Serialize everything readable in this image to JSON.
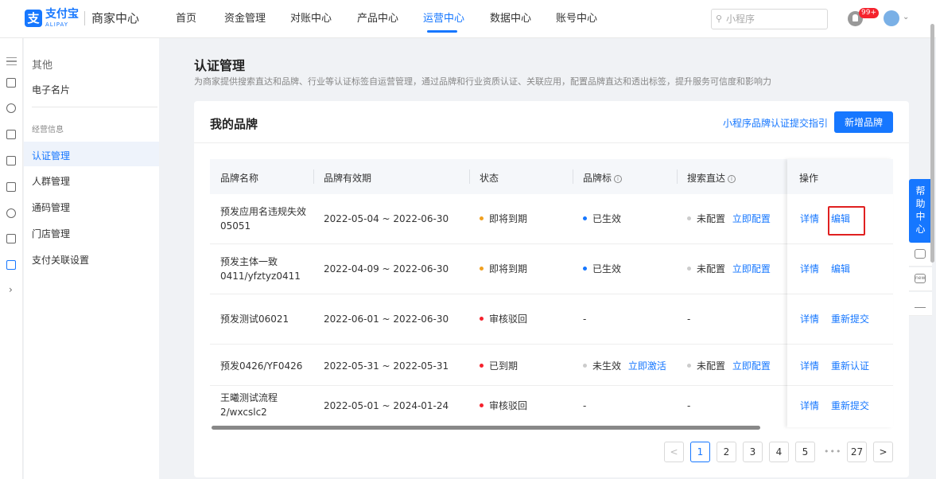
{
  "header": {
    "logo_mark": "支",
    "logo_text": "支付宝",
    "logo_sub": "ALIPAY",
    "app_name": "商家中心",
    "nav": [
      "首页",
      "资金管理",
      "对账中心",
      "产品中心",
      "运营中心",
      "数据中心",
      "账号中心"
    ],
    "active_nav": "运营中心",
    "search_placeholder": "小程序",
    "notification_badge": "99+"
  },
  "sidebar": {
    "group_other": "其他",
    "item_card": "电子名片",
    "section_business": "经营信息",
    "items": [
      "认证管理",
      "人群管理",
      "通码管理",
      "门店管理",
      "支付关联设置"
    ],
    "active_item": "认证管理"
  },
  "page": {
    "title": "认证管理",
    "description": "为商家提供搜索直达和品牌、行业等认证标签自运营管理，通过品牌和行业资质认证、关联应用，配置品牌直达和透出标签，提升服务可信度和影响力"
  },
  "card": {
    "title": "我的品牌",
    "guide_link": "小程序品牌认证提交指引",
    "add_button": "新增品牌"
  },
  "table": {
    "columns": [
      "品牌名称",
      "品牌有效期",
      "状态",
      "品牌标",
      "搜索直达",
      "操作"
    ],
    "info_glyph": "i",
    "rows": [
      {
        "name": "预发应用名违规失效05051",
        "period": "2022-05-04 ~ 2022-06-30",
        "status": "即将到期",
        "status_color": "#f0a020",
        "mark": "已生效",
        "mark_color": "#1677ff",
        "mark_action": "",
        "search": "未配置",
        "search_action": "立即配置",
        "op1": "详情",
        "op2": "编辑"
      },
      {
        "name": "预发主体一致0411/yfztyz0411",
        "period": "2022-04-09 ~ 2022-06-30",
        "status": "即将到期",
        "status_color": "#f0a020",
        "mark": "已生效",
        "mark_color": "#1677ff",
        "mark_action": "",
        "search": "未配置",
        "search_action": "立即配置",
        "op1": "详情",
        "op2": "编辑"
      },
      {
        "name": "预发测试06021",
        "period": "2022-06-01 ~ 2022-06-30",
        "status": "审核驳回",
        "status_color": "#f5222d",
        "mark": "-",
        "mark_color": "",
        "mark_action": "",
        "search": "-",
        "search_action": "",
        "op1": "详情",
        "op2": "重新提交"
      },
      {
        "name": "预发0426/YF0426",
        "period": "2022-05-31 ~ 2022-05-31",
        "status": "已到期",
        "status_color": "#f5222d",
        "mark": "未生效",
        "mark_color": "#cccccc",
        "mark_action": "立即激活",
        "search": "未配置",
        "search_action": "立即配置",
        "op1": "详情",
        "op2": "重新认证"
      },
      {
        "name": "王曦测试流程2/wxcslc2",
        "period": "2022-05-01 ~ 2024-01-24",
        "status": "审核驳回",
        "status_color": "#f5222d",
        "mark": "-",
        "mark_color": "",
        "mark_action": "",
        "search": "-",
        "search_action": "",
        "op1": "详情",
        "op2": "重新提交"
      }
    ]
  },
  "pagination": {
    "prev": "<",
    "pages": [
      "1",
      "2",
      "3",
      "4",
      "5"
    ],
    "ellipsis": "•••",
    "last": "27",
    "next": ">",
    "current": "1"
  },
  "help": {
    "label": "帮助中心",
    "new_tag": "new"
  }
}
